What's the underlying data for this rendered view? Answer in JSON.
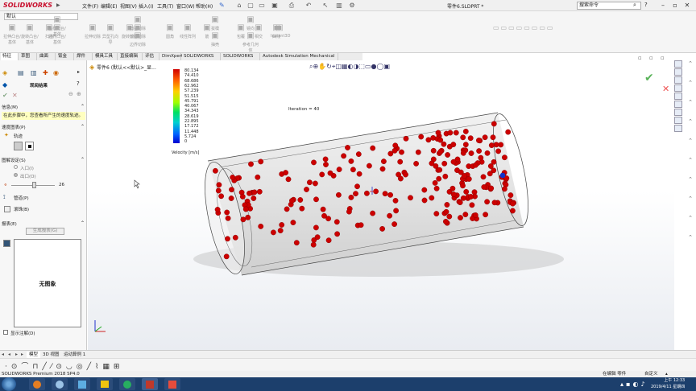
{
  "app": {
    "logo": "SOLIDWORKS",
    "logo_arrow": "▶",
    "document_title": "零件6.SLDPRT *",
    "search_placeholder": "搜索命令"
  },
  "menu": [
    "文件(F)",
    "编辑(E)",
    "视图(V)",
    "插入(I)",
    "工具(T)",
    "窗口(W)",
    "帮助(H)"
  ],
  "quick_icons": [
    {
      "name": "home-icon",
      "glyph": "⌂"
    },
    {
      "name": "new-document-icon",
      "glyph": "▢"
    },
    {
      "name": "open-folder-icon",
      "glyph": "▭"
    },
    {
      "name": "save-icon",
      "glyph": "▣"
    },
    {
      "name": "print-icon",
      "glyph": "⎙"
    },
    {
      "name": "undo-icon",
      "glyph": "↶"
    },
    {
      "name": "select-arrow-icon",
      "glyph": "↖"
    },
    {
      "name": "rebuild-icon",
      "glyph": "▥"
    },
    {
      "name": "options-icon",
      "glyph": "⚙"
    }
  ],
  "config_value": "默认",
  "ribbon_buttons": [
    "拉伸凸台/基体",
    "旋转凸台/基体",
    "扫描",
    "放样凸台/基体",
    "边界凸台/基体",
    "拉伸切除",
    "异型孔向导",
    "旋转切除",
    "扫描切除",
    "放样切除",
    "边界切除",
    "圆角",
    "线性阵列",
    "筋",
    "拔模",
    "抽壳",
    "包覆",
    "相交",
    "镜向",
    "参考几何体",
    "曲线",
    "Instant3D"
  ],
  "tabs": [
    "特征",
    "草图",
    "曲面",
    "钣金",
    "焊件",
    "模具工具",
    "直接编辑",
    "评估",
    "DimXpert",
    "SOLIDWORKS 插件",
    "SOLIDWORKS MBD",
    "Autodesk Simulation Mechanical 2016"
  ],
  "active_tab": 0,
  "property_manager": {
    "title": "观阅结果",
    "info_header": "信息(M)",
    "info_text": "在此步骤中，您查看所产生的速度轨迹。",
    "speed_header": "速度图表(P)",
    "speed_item": "轨迹",
    "settings_header": "图解设定(S)",
    "inlet": "入口(I)",
    "outlet": "出口(O)",
    "slider_value": "26",
    "pipe_label": "管道(P)",
    "ball_label": "滚珠(B)",
    "report_header": "报表(E)",
    "generate_button": "生成报表(G)",
    "preview_text": "无图象",
    "annotation_checkbox": "显示注解(D)"
  },
  "feature_tree": {
    "text": "零件6 (默认<<默认>_显..."
  },
  "iteration_label": "Iteration = 40",
  "colorbar": {
    "unit": "Velocity [m/s]",
    "ticks": [
      "80.134",
      "74.410",
      "68.686",
      "62.962",
      "57.239",
      "51.515",
      "45.791",
      "40.067",
      "34.343",
      "28.619",
      "22.895",
      "17.172",
      "11.448",
      "5.724",
      "0"
    ],
    "colors": [
      "#d00000",
      "#ff6000",
      "#ffd000",
      "#a0ff00",
      "#00e060",
      "#00d0d0",
      "#0060ff",
      "#0000d0"
    ]
  },
  "particle_color": "#cc0000",
  "bottom_tabs": [
    "模型",
    "3D 视图",
    "运动算例 1"
  ],
  "status": {
    "left": "SOLIDWORKS Premium 2018 SP4.0",
    "mode": "在编辑 零件",
    "units": "自定义"
  },
  "clock": {
    "time": "上午 12:33",
    "date": "2019/4/11 星期四"
  }
}
